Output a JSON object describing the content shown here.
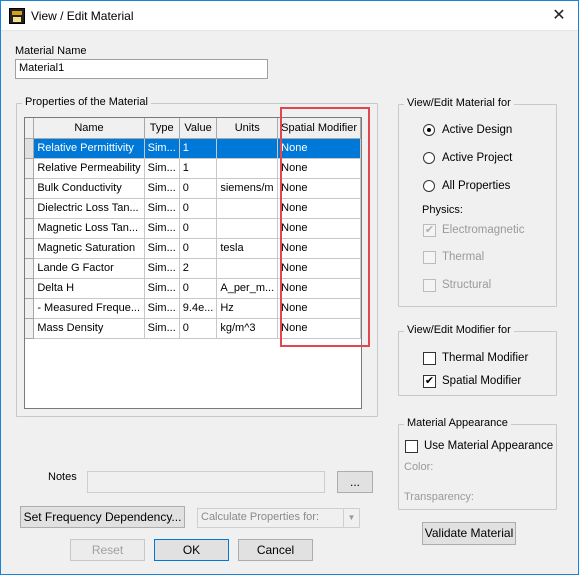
{
  "window": {
    "title": "View / Edit Material",
    "close_glyph": "✕"
  },
  "material_name": {
    "label": "Material Name",
    "value": "Material1"
  },
  "properties": {
    "group_title": "Properties of the Material",
    "columns": [
      "Name",
      "Type",
      "Value",
      "Units",
      "Spatial Modifier"
    ],
    "rows": [
      {
        "name": "Relative Permittivity",
        "type": "Sim...",
        "value": "1",
        "units": "",
        "modifier": "None",
        "selected": true
      },
      {
        "name": "Relative Permeability",
        "type": "Sim...",
        "value": "1",
        "units": "",
        "modifier": "None"
      },
      {
        "name": "Bulk Conductivity",
        "type": "Sim...",
        "value": "0",
        "units": "siemens/m",
        "modifier": "None"
      },
      {
        "name": "Dielectric Loss Tan...",
        "type": "Sim...",
        "value": "0",
        "units": "",
        "modifier": "None"
      },
      {
        "name": "Magnetic Loss Tan...",
        "type": "Sim...",
        "value": "0",
        "units": "",
        "modifier": "None"
      },
      {
        "name": "Magnetic Saturation",
        "type": "Sim...",
        "value": "0",
        "units": "tesla",
        "modifier": "None"
      },
      {
        "name": "Lande G Factor",
        "type": "Sim...",
        "value": "2",
        "units": "",
        "modifier": "None"
      },
      {
        "name": "Delta H",
        "type": "Sim...",
        "value": "0",
        "units": "A_per_m...",
        "modifier": "None"
      },
      {
        "name": "- Measured Freque...",
        "type": "Sim...",
        "value": "9.4e...",
        "units": "Hz",
        "modifier": "None"
      },
      {
        "name": "Mass Density",
        "type": "Sim...",
        "value": "0",
        "units": "kg/m^3",
        "modifier": "None"
      }
    ],
    "highlight_color": "#e0484e",
    "selection_color": "#0078d7"
  },
  "view_edit_for": {
    "title": "View/Edit Material for",
    "options": [
      "Active Design",
      "Active Project",
      "All Properties"
    ],
    "selected": "Active Design",
    "physics_label": "Physics:",
    "physics": [
      {
        "label": "Electromagnetic",
        "checked": true
      },
      {
        "label": "Thermal",
        "checked": false
      },
      {
        "label": "Structural",
        "checked": false
      }
    ]
  },
  "modifier_for": {
    "title": "View/Edit Modifier for",
    "thermal": {
      "label": "Thermal Modifier",
      "checked": false
    },
    "spatial": {
      "label": "Spatial Modifier",
      "checked": true
    }
  },
  "appearance": {
    "title": "Material Appearance",
    "use_label": "Use Material Appearance",
    "color_label": "Color:",
    "transparency_label": "Transparency:"
  },
  "notes": {
    "label": "Notes",
    "value": "",
    "browse_label": "..."
  },
  "buttons": {
    "set_freq": "Set Frequency Dependency...",
    "calc_props": "Calculate Properties for:",
    "validate": "Validate Material",
    "reset": "Reset",
    "ok": "OK",
    "cancel": "Cancel"
  }
}
